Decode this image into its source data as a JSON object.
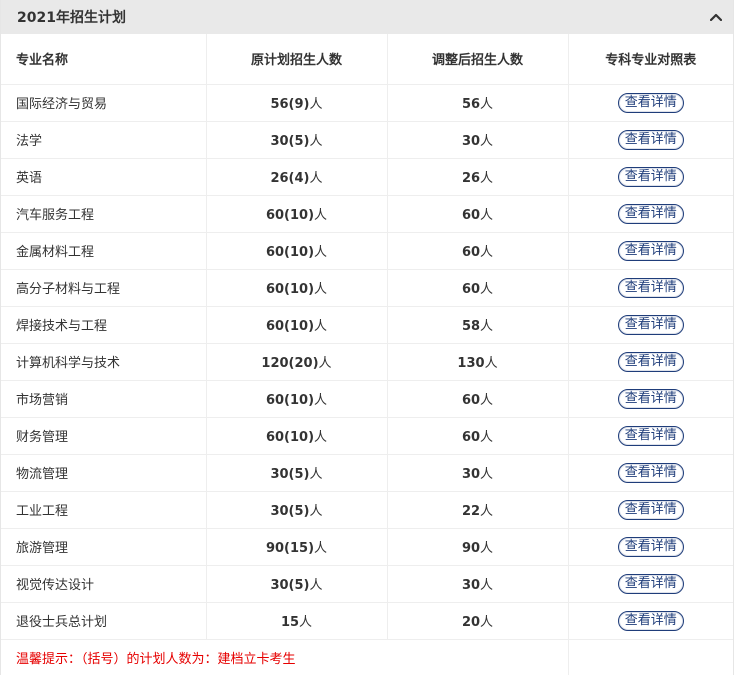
{
  "panel": {
    "title": "2021年招生计划"
  },
  "table": {
    "headers": {
      "major": "专业名称",
      "original": "原计划招生人数",
      "adjusted": "调整后招生人数",
      "reference": "专科专业对照表"
    },
    "detail_label": "查看详情",
    "rows": [
      {
        "major": "国际经济与贸易",
        "original_num": "56(9)",
        "original_unit": "人",
        "adjusted_num": "56",
        "adjusted_unit": "人"
      },
      {
        "major": "法学",
        "original_num": "30(5)",
        "original_unit": "人",
        "adjusted_num": "30",
        "adjusted_unit": "人"
      },
      {
        "major": "英语",
        "original_num": "26(4)",
        "original_unit": "人",
        "adjusted_num": "26",
        "adjusted_unit": "人"
      },
      {
        "major": "汽车服务工程",
        "original_num": "60(10)",
        "original_unit": "人",
        "adjusted_num": "60",
        "adjusted_unit": "人"
      },
      {
        "major": "金属材料工程",
        "original_num": "60(10)",
        "original_unit": "人",
        "adjusted_num": "60",
        "adjusted_unit": "人"
      },
      {
        "major": "高分子材料与工程",
        "original_num": "60(10)",
        "original_unit": "人",
        "adjusted_num": "60",
        "adjusted_unit": "人"
      },
      {
        "major": "焊接技术与工程",
        "original_num": "60(10)",
        "original_unit": "人",
        "adjusted_num": "58",
        "adjusted_unit": "人"
      },
      {
        "major": "计算机科学与技术",
        "original_num": "120(20)",
        "original_unit": "人",
        "adjusted_num": "130",
        "adjusted_unit": "人"
      },
      {
        "major": "市场营销",
        "original_num": "60(10)",
        "original_unit": "人",
        "adjusted_num": "60",
        "adjusted_unit": "人"
      },
      {
        "major": "财务管理",
        "original_num": "60(10)",
        "original_unit": "人",
        "adjusted_num": "60",
        "adjusted_unit": "人"
      },
      {
        "major": "物流管理",
        "original_num": "30(5)",
        "original_unit": "人",
        "adjusted_num": "30",
        "adjusted_unit": "人"
      },
      {
        "major": "工业工程",
        "original_num": "30(5)",
        "original_unit": "人",
        "adjusted_num": "22",
        "adjusted_unit": "人"
      },
      {
        "major": "旅游管理",
        "original_num": "90(15)",
        "original_unit": "人",
        "adjusted_num": "90",
        "adjusted_unit": "人"
      },
      {
        "major": "视觉传达设计",
        "original_num": "30(5)",
        "original_unit": "人",
        "adjusted_num": "30",
        "adjusted_unit": "人"
      },
      {
        "major": "退役士兵总计划",
        "original_num": "15",
        "original_unit": "人",
        "adjusted_num": "20",
        "adjusted_unit": "人"
      }
    ],
    "notice": "温馨提示：（括号）的计划人数为：建档立卡考生"
  },
  "icons": {
    "collapse": "chevron-up-icon"
  },
  "colors": {
    "header_bg": "#e9e9e9",
    "button_accent": "#1f3d7a",
    "notice_text": "#e60000"
  }
}
